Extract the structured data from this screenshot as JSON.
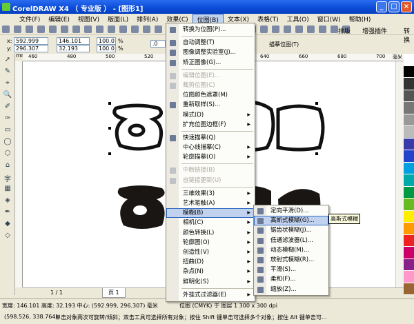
{
  "window": {
    "title": "CorelDRAW X4 （ 专业版 ） - [图形1]"
  },
  "menubar": [
    "文件(F)",
    "编辑(E)",
    "视图(V)",
    "版面(L)",
    "排列(A)",
    "效果(C)",
    "位图(B)",
    "文本(X)",
    "表格(T)",
    "工具(O)",
    "窗口(W)",
    "帮助(H)"
  ],
  "menubar_active": "位图(B)",
  "toolbar": {
    "buttons": [
      "排版",
      "增强插件",
      "转换"
    ]
  },
  "propbar": {
    "x": "592.999 mm",
    "y": "296.307 mm",
    "width": "146.101 mm",
    "height": "32.193 mm",
    "scale_x": "100.0",
    "scale_y": "100.0",
    "pct": "%",
    "rotation": ".0",
    "trace_bitmap": "描摹位图(T)",
    "x_label": "x:",
    "y_label": "y:"
  },
  "ruler": {
    "ticks": [
      "460",
      "480",
      "500",
      "520",
      "540",
      "620",
      "640",
      "660",
      "680",
      "700"
    ],
    "unit": "毫米"
  },
  "bitmap_menu": [
    {
      "label": "转换为位图(P)...",
      "icon": "convert-icon"
    },
    {
      "sep": true
    },
    {
      "label": "自动调整(T)",
      "icon": "auto-adjust-icon"
    },
    {
      "label": "图像调整实验室(J)...",
      "icon": "image-lab-icon"
    },
    {
      "label": "矫正图像(G)...",
      "icon": "straighten-icon"
    },
    {
      "sep": true
    },
    {
      "label": "编辑位图(E)...",
      "disabled": true,
      "icon": "edit-bitmap-icon"
    },
    {
      "label": "裁剪位图(C)",
      "disabled": true,
      "icon": "crop-icon"
    },
    {
      "label": "位图颜色遮罩(M)"
    },
    {
      "label": "重新取样(S)...",
      "icon": "resample-icon"
    },
    {
      "label": "模式(D)",
      "submenu": true
    },
    {
      "label": "扩充位图边框(F)",
      "submenu": true
    },
    {
      "sep": true
    },
    {
      "label": "快速描摹(Q)",
      "icon": "quick-trace-icon"
    },
    {
      "label": "中心线描摹(C)",
      "submenu": true
    },
    {
      "label": "轮廓描摹(O)",
      "submenu": true
    },
    {
      "sep": true
    },
    {
      "label": "中断链接(B)",
      "disabled": true,
      "icon": "break-link-icon"
    },
    {
      "label": "自链接更新(U)",
      "disabled": true,
      "icon": "update-link-icon"
    },
    {
      "sep": true
    },
    {
      "label": "三维效果(3)",
      "submenu": true
    },
    {
      "label": "艺术笔触(A)",
      "submenu": true
    },
    {
      "label": "模糊(B)",
      "submenu": true,
      "highlighted": true
    },
    {
      "label": "相机(C)",
      "submenu": true
    },
    {
      "label": "颜色转换(L)",
      "submenu": true
    },
    {
      "label": "轮廓图(O)",
      "submenu": true
    },
    {
      "label": "创造性(V)",
      "submenu": true
    },
    {
      "label": "扭曲(D)",
      "submenu": true
    },
    {
      "label": "杂点(N)",
      "submenu": true
    },
    {
      "label": "鲜明化(S)",
      "submenu": true
    },
    {
      "sep": true
    },
    {
      "label": "外挂式过滤器(E)",
      "submenu": true
    }
  ],
  "blur_menu": [
    {
      "label": "定向平滑(D)...",
      "icon": "directional-smooth-icon"
    },
    {
      "label": "高斯式模糊(G)...",
      "icon": "gaussian-blur-icon",
      "highlighted": true
    },
    {
      "label": "锯齿状模糊(J)...",
      "icon": "jaggy-blur-icon"
    },
    {
      "label": "低通滤波器(L)...",
      "icon": "low-pass-icon"
    },
    {
      "label": "动态模糊(M)...",
      "icon": "motion-blur-icon"
    },
    {
      "label": "放射式模糊(R)...",
      "icon": "radial-blur-icon"
    },
    {
      "label": "平滑(S)...",
      "icon": "smooth-icon"
    },
    {
      "label": "柔和(F)...",
      "icon": "soften-icon"
    },
    {
      "label": "缩放(Z)...",
      "icon": "zoom-blur-icon"
    }
  ],
  "tooltip": "高斯式模糊",
  "pages": {
    "counter": "1 / 1",
    "tab": "页 1"
  },
  "status": {
    "line1_left": "宽度: 146.101 高度: 32.193 中心: (592.999, 296.307) 毫米",
    "line1_right": "位图 (CMYK) 于 图层 1 300 x 300 dpi",
    "coords": "(598.526, 338.764)",
    "hint": "单击对象两次可旋转/倾斜；双击工具可选择所有对象；按住 Shift 键单击可选择多个对象；按住 Alt 键单击可..."
  },
  "palette": [
    "#ffffff",
    "#000000",
    "#333333",
    "#555555",
    "#777777",
    "#999999",
    "#bbbbbb",
    "#3a3aa8",
    "#2244cc",
    "#00a0e0",
    "#00aaaa",
    "#009944",
    "#66bb22",
    "#ffee00",
    "#ff9900",
    "#ee2222",
    "#cc0066",
    "#882288",
    "#ff99cc",
    "#996633"
  ],
  "colors": {
    "title_bar": "#0a4bd6",
    "highlight": "#c1d2ee"
  }
}
